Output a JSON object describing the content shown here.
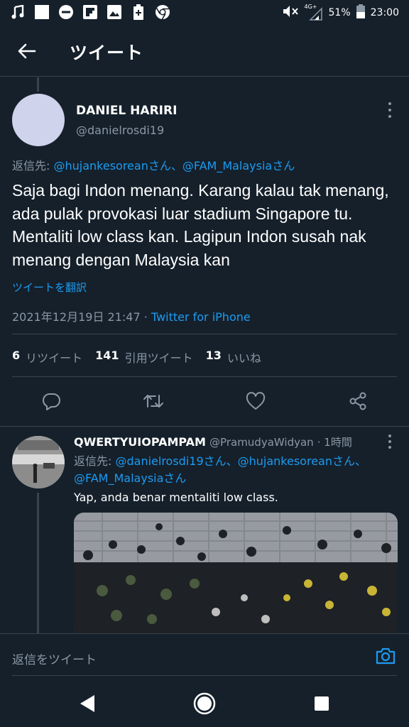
{
  "status_bar": {
    "left_icons": [
      "music-note-icon",
      "blank-square-icon",
      "minus-circle-icon",
      "flipboard-icon",
      "gallery-icon",
      "battery-plus-icon",
      "chrome-icon"
    ],
    "network": "4G+",
    "battery": "51%",
    "time": "23:00"
  },
  "header": {
    "title": "ツイート"
  },
  "tweet": {
    "name": "DANIEL HARIRI",
    "handle": "@danielrosdi19",
    "reply_prefix": "返信先: ",
    "reply_to": "@hujankesoreanさん、@FAM_Malaysiaさん",
    "text": "Saja bagi Indon menang. Karang kalau tak menang, ada pulak provokasi luar stadium Singapore tu. Mentaliti low class kan. Lagipun Indon susah nak menang dengan Malaysia kan",
    "translate": "ツイートを翻訳",
    "timestamp": "2021年12月19日 21:47 · ",
    "source": "Twitter for iPhone",
    "retweets_count": "6",
    "retweets_label": "リツイート",
    "quotes_count": "141",
    "quotes_label": "引用ツイート",
    "likes_count": "13",
    "likes_label": "いいね"
  },
  "reply": {
    "name": "QWERTYUIOPAMPAM",
    "handle": "@PramudyaWidyan",
    "time": "· 1時間",
    "reply_prefix": "返信先: ",
    "reply_to": "@danielrosdi19さん、@hujankesoreanさん、@FAM_Malaysiaさん",
    "text": "Yap, anda benar mentaliti low class."
  },
  "compose": {
    "placeholder": "返信をツイート"
  },
  "colors": {
    "background": "#15202b",
    "accent": "#1d9bf0",
    "muted": "#8b98a5",
    "border": "#38444d"
  }
}
